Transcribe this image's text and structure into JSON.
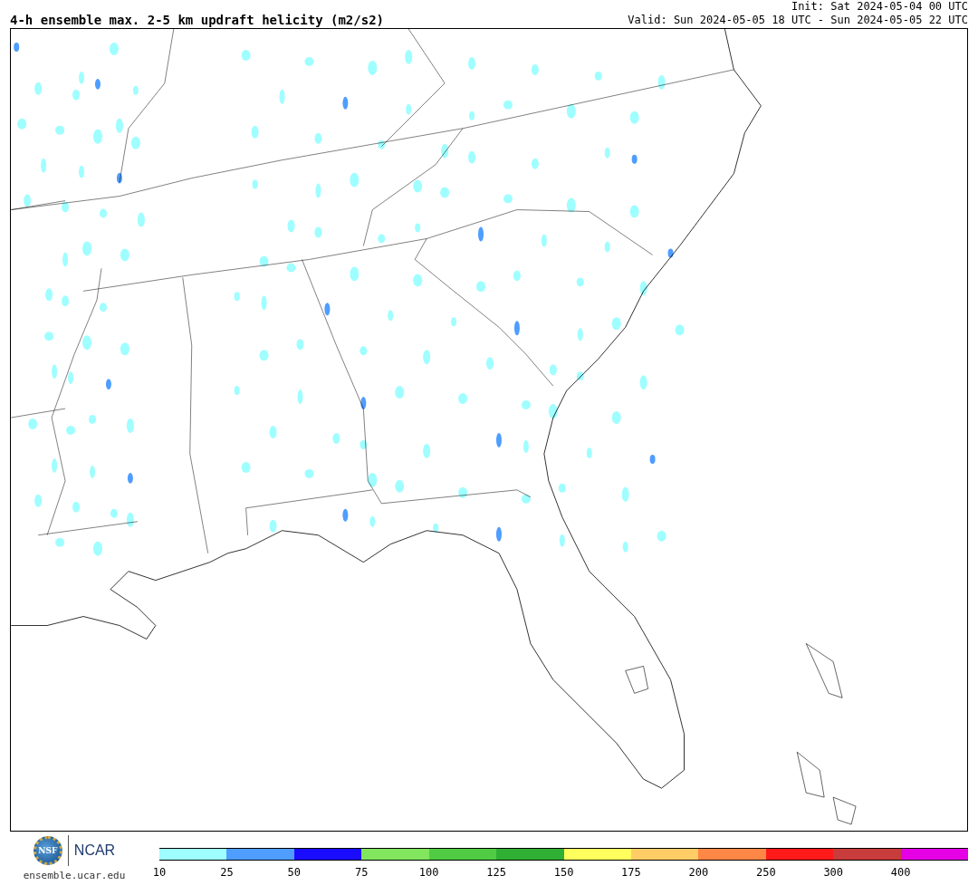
{
  "title": "4-h ensemble max. 2-5 km updraft helicity (m2/s2)",
  "init": "Init: Sat 2024-05-04 00 UTC",
  "valid": "Valid: Sun 2024-05-05 18 UTC - Sun 2024-05-05 22 UTC",
  "logos": {
    "nsf": "NSF",
    "ncar": "NCAR",
    "site": "ensemble.ucar.edu"
  },
  "colorbar": [
    {
      "color": "#9ffeff",
      "label": "10"
    },
    {
      "color": "#4f9dff",
      "label": "25"
    },
    {
      "color": "#1a0cff",
      "label": "50"
    },
    {
      "color": "#82e55e",
      "label": "75"
    },
    {
      "color": "#50cc44",
      "label": "100"
    },
    {
      "color": "#2fb034",
      "label": "125"
    },
    {
      "color": "#ffff5e",
      "label": "150"
    },
    {
      "color": "#ffcc66",
      "label": "175"
    },
    {
      "color": "#ff8746",
      "label": "200"
    },
    {
      "color": "#ff1a1a",
      "label": "250"
    },
    {
      "color": "#c83c3c",
      "label": "300"
    },
    {
      "color": "#e600e6",
      "label": "400"
    }
  ]
}
